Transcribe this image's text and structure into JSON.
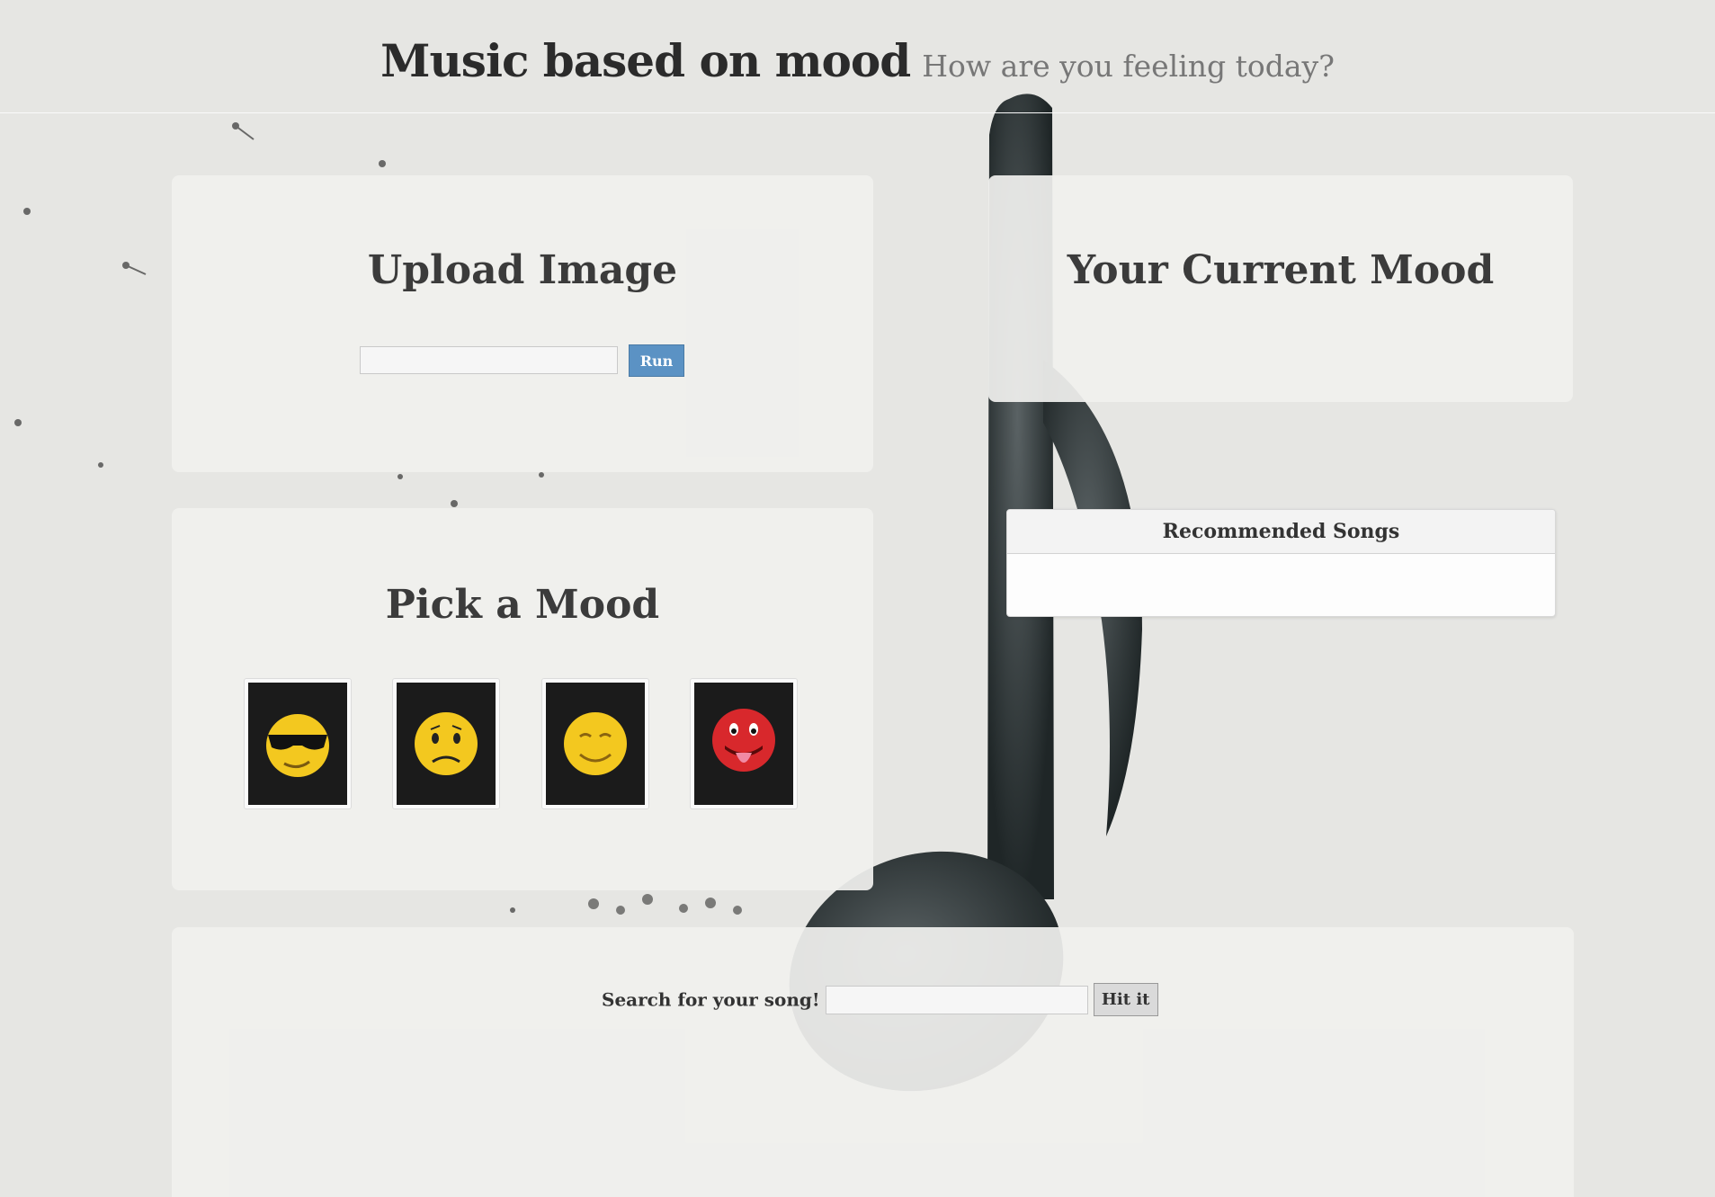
{
  "header": {
    "title": "Music based on mood",
    "subtitle": "How are you feeling today?"
  },
  "upload": {
    "title": "Upload Image",
    "run_label": "Run"
  },
  "pick_mood": {
    "title": "Pick a Mood",
    "moods": [
      {
        "icon": "cool-sunglasses-emoji-icon",
        "face_color": "#f3c81f"
      },
      {
        "icon": "sad-emoji-icon",
        "face_color": "#f3c81f"
      },
      {
        "icon": "content-smile-emoji-icon",
        "face_color": "#f3c81f"
      },
      {
        "icon": "playful-tongue-emoji-icon",
        "face_color": "#d8282c"
      }
    ]
  },
  "current_mood": {
    "title": "Your Current Mood"
  },
  "recommended": {
    "title": "Recommended Songs"
  },
  "search": {
    "label": "Search for your song!",
    "button_label": "Hit it"
  },
  "colors": {
    "background": "#e6e6e3",
    "panel": "#f0f0ee",
    "run_button": "#5b92c4",
    "note": "#2c3436"
  }
}
